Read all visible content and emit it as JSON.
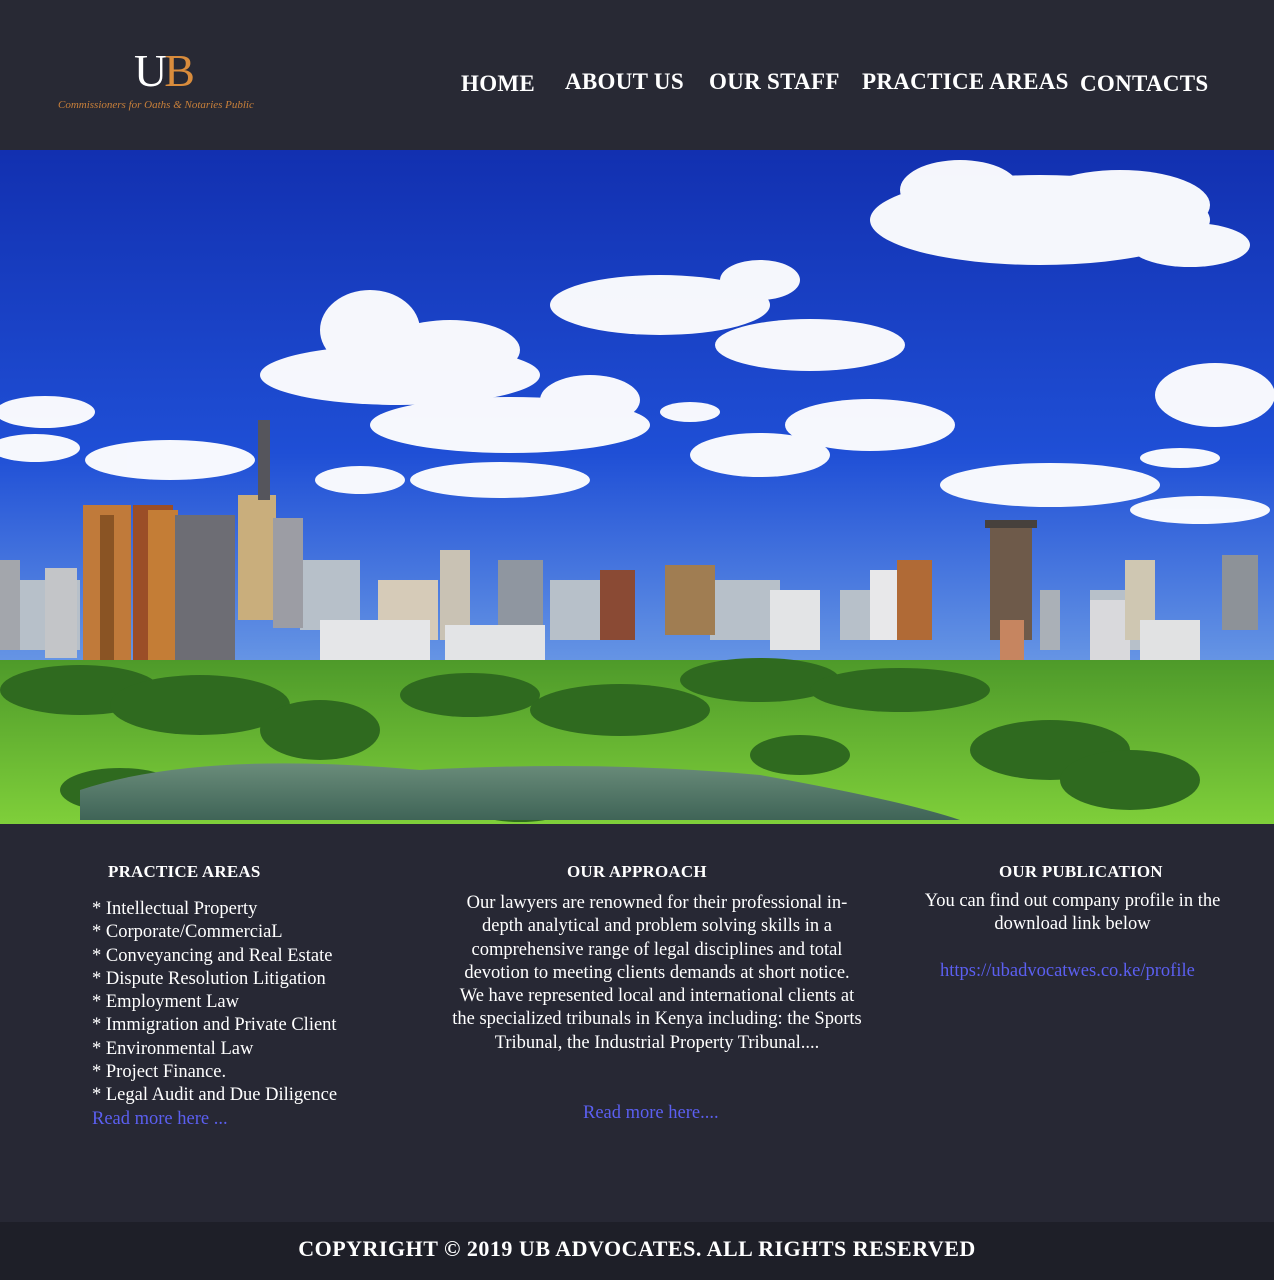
{
  "brand": {
    "logo_u": "U",
    "logo_b": "B",
    "tagline": "Commissioners for Oaths & Notaries Public"
  },
  "nav": {
    "home": "HOME",
    "about": "ABOUT US",
    "staff": "OUR STAFF",
    "practice": "PRACTICE AREAS",
    "contacts": "CONTACTS"
  },
  "practice_areas": {
    "title": "PRACTICE AREAS",
    "items": [
      "* Intellectual Property",
      "* Corporate/CommerciaL",
      "* Conveyancing and Real Estate",
      "* Dispute Resolution Litigation",
      "* Employment Law",
      "* Immigration and Private Client",
      "* Environmental Law",
      "* Project Finance.",
      "* Legal Audit and Due Diligence"
    ],
    "read_more": "Read more here ..."
  },
  "approach": {
    "title": "OUR APPROACH",
    "text": "Our lawyers are renowned for their professional in-depth analytical and problem solving skills in a comprehensive range of legal disciplines and total devotion to meeting clients demands at short notice. We have represented local and international clients at the specialized tribunals in Kenya including: the Sports Tribunal, the Industrial Property Tribunal....",
    "read_more": "Read more here...."
  },
  "publication": {
    "title": "OUR PUBLICATION",
    "text": "You can find out company profile in the download link below",
    "link": "https://ubadvocatwes.co.ke/profile"
  },
  "footer": {
    "copyright": "COPYRIGHT © 2019 UB ADVOCATES. ALL RIGHTS RESERVED"
  },
  "colors": {
    "background": "#272834",
    "footer": "#1e1f28",
    "link": "#5b5ff0",
    "brand_accent": "#d98c3c"
  }
}
